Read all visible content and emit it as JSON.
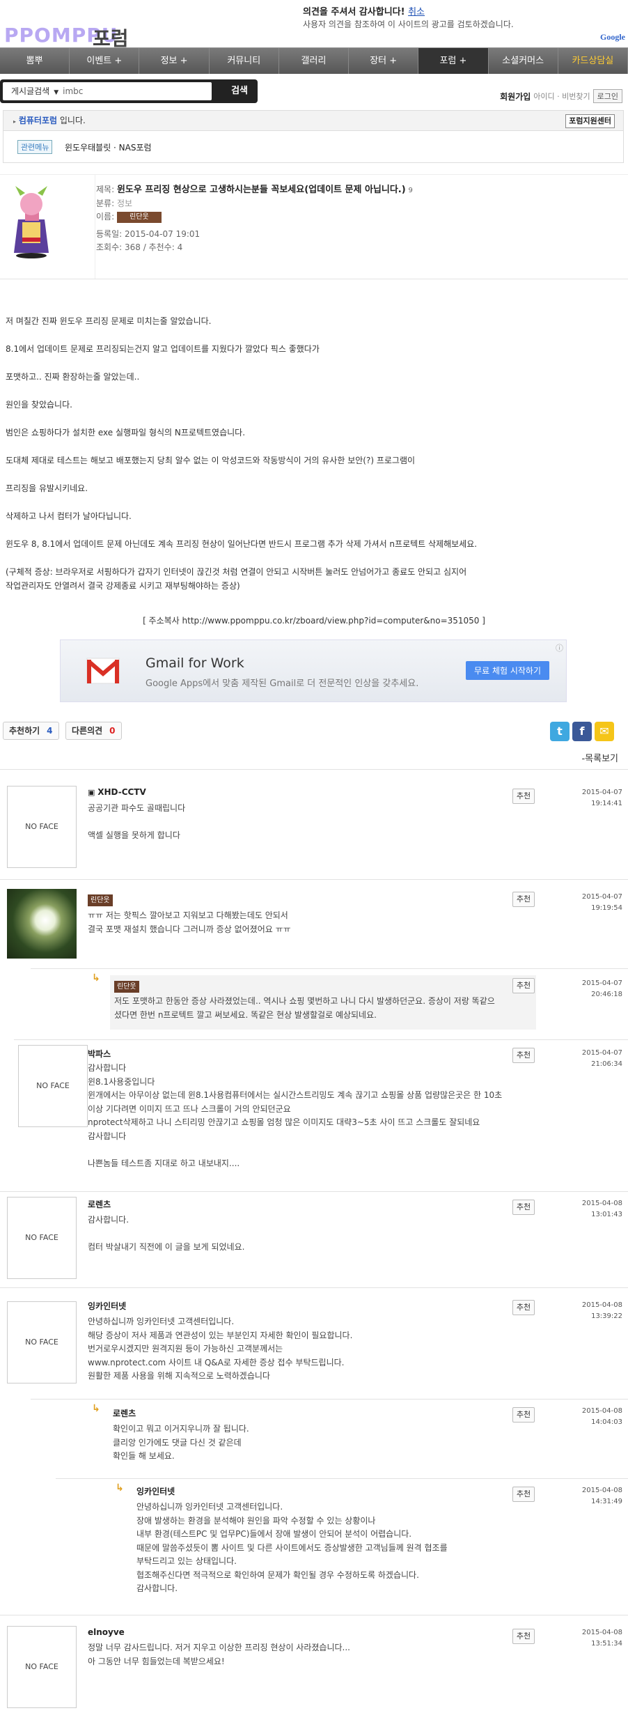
{
  "header": {
    "logo": "PPOMPPU",
    "logo_suffix": "포럼",
    "ad_title": "의견을 주셔서 감사합니다!",
    "ad_cancel": "취소",
    "ad_sub": "사용자 의견을 참조하여 이 사이트의 광고를 검토하겠습니다.",
    "google": "Google"
  },
  "nav": [
    "뽐뿌",
    "이벤트 +",
    "정보 +",
    "커뮤니티",
    "갤러리",
    "장터 +",
    "포럼 +",
    "소셜커머스",
    "카드상담실"
  ],
  "search": {
    "select": "게시글검색",
    "query": "imbc",
    "button": "검색"
  },
  "member": {
    "join": "회원가입",
    "find": "아이디 · 비번찾기",
    "login": "로그인"
  },
  "breadcrumb": {
    "link": "컴퓨터포럼",
    "suffix": "입니다.",
    "support": "포럼지원센터"
  },
  "related": {
    "tag": "관련메뉴",
    "text": "윈도우태블릿 · NAS포럼"
  },
  "post": {
    "title_label": "제목:",
    "title": "윈도우 프리징 현상으로 고생하시는분들 꼭보세요(업데이트 문제 아닙니다.)",
    "title_count": "9",
    "category_label": "분류:",
    "category": "정보",
    "name_label": "이름:",
    "nick": "린단웃",
    "date_label": "등록일:",
    "date": "2015-04-07 19:01",
    "views_label": "조회수:",
    "views": "368",
    "rec_label": "/ 추천수:",
    "recs": "4"
  },
  "body": [
    "저 며칠간 진짜 윈도우 프리징 문제로 미치는줄 알았습니다.",
    "8.1에서 업데이트 문제로 프리징되는건지 알고 업데이트를 지웠다가 깔았다 픽스 좋했다가",
    "포맷하고.. 진짜 환장하는줄 알았는데..",
    "원인을 찾았습니다.",
    "범인은 쇼핑하다가 설치한 exe 실행파일 형식의 N프로텍트였습니다.",
    "도대체 제대로 테스트는 해보고 배포했는지 당최 알수 없는 이 악성코드와 작동방식이 거의 유사한 보안(?) 프로그램이",
    "프리징을 유발시키네요.",
    "삭제하고 나서 컴터가 날아다닙니다.",
    "윈도우 8, 8.1에서 업데이트 문제 아닌데도 계속 프리징 현상이 일어난다면 반드시 프로그램 추가 삭제 가셔서 n프로텍트 삭제해보세요.",
    "(구체적 증상: 브라우저로 서핑하다가 갑자기 인터넷이 끊긴것 처럼 연결이 안되고 시작버튼 눌러도 안넘어가고 종료도 안되고 심지어",
    "작업관리자도 안열려서 결국 강제종료 시키고 재부팅해야하는 증상)"
  ],
  "address": "[ 주소복사 http://www.ppomppu.co.kr/zboard/view.php?id=computer&no=351050 ]",
  "gmail_ad": {
    "headline": "Gmail for Work",
    "sub": "Google Apps에서 맞춤 제작된 Gmail로 더 전문적인 인상을 갖추세요.",
    "cta": "무료 체험 시작하기"
  },
  "actions": {
    "recommend": "추천하기",
    "recommend_count": "4",
    "dissent": "다른의견",
    "dissent_count": "0",
    "back": "-목록보기"
  },
  "comment_ui": {
    "no_face": "NO FACE",
    "recommend": "추천"
  },
  "comments": [
    {
      "name": "XHD-CCTV",
      "text": "공공기관 파수도 골때립니다\n\n액셀 실행을 못하게 합니다",
      "date": "2015-04-07",
      "time": "19:14:41"
    },
    {
      "name": "",
      "badge": "린단웃",
      "text": "ㅠㅠ 저는 핫픽스 깔아보고 지워보고 다해봤는데도 안되서\n결국 포맷 재설치 했습니다 그러니까 증상 없어졌어요 ㅠㅠ",
      "date": "2015-04-07",
      "time": "19:19:54"
    },
    {
      "name": "",
      "badge": "린단웃",
      "text": "저도 포맷하고 한동안 증상 사라졌었는데.. 역시나 쇼핑 몇번하고 나니 다시 발생하던군요. 증상이 저랑 똑같으\n셨다면 한번 n프로텍트 깔고 써보세요. 똑같은 현상 발생할걸로 예상되네요.",
      "date": "2015-04-07",
      "time": "20:46:18"
    },
    {
      "name": "박파스",
      "text": "감사합니다\n윈8.1사용중입니다\n윈개에서는 아무이상 없는데 윈8.1사용컴퓨터에서는 실시간스트리밍도 계속 끊기고 쇼핑몰 상품 업량많은곳은 한 10초\n이상 기다려면 이미지 뜨고 뜨나 스크롤이 거의 안되던군요\nnprotect삭제하고 나니 스티리밍 안끊기고 쇼핑몰 엄청 많은 이미지도 대략3~5초 사이 뜨고 스크롤도 잘되네요\n감사합니다\n\n나쁜놈들 테스트좀 지대로 하고 내보내지....",
      "date": "2015-04-07",
      "time": "21:06:34"
    },
    {
      "name": "로렌츠",
      "text": "감사합니다.\n\n컴터 박살내기 직전에 이 글을 보게 되었네요.",
      "date": "2015-04-08",
      "time": "13:01:43"
    },
    {
      "name": "잉카인터넷",
      "text": "안녕하십니까 잉카인터넷 고객센터입니다.\n해당 증상이 저사 제품과 연관성이 있는 부분인지 자세한 확인이 필요합니다.\n번거로우시겠지만 원격지원 등이 가능하신 고객분께서는\nwww.nprotect.com 사이트 내 Q&A로 자세한 증상 접수 부탁드립니다.\n원활한 제품 사용을 위해 지속적으로 노력하겠습니다",
      "date": "2015-04-08",
      "time": "13:39:22"
    },
    {
      "name": "로렌츠",
      "text": "확인이고 뭐고 이거지우니까 잘 됩니다.\n클리앙 인가에도 댓글 다신 것 같은데\n확인들 해 보세요.",
      "date": "2015-04-08",
      "time": "14:04:03"
    },
    {
      "name": "잉카인터넷",
      "text": "안녕하십니까 잉카인터넷 고객센터입니다.\n장애 발생하는 환경을 분석해야 원인을 파악 수정할 수 있는 상황이나\n내부 환경(테스트PC 및 업무PC)들에서 장애 발생이 안되어 분석이 어렵습니다.\n때문에 말씀주셨듯이 뽐 사이트 및 다른 사이트에서도 증상발생한 고객님들께 원격 협조를\n부탁드리고 있는 상태입니다.\n협조해주신다면 적극적으로 확인하여 문제가 확인될 경우 수정하도록 하겠습니다.\n감사합니다.",
      "date": "2015-04-08",
      "time": "14:31:49"
    },
    {
      "name": "elnoyve",
      "text": "정말 너무 감사드립니다. 저거 지우고 이상한 프리징 현상이 사라졌습니다...\n아 그동안 너무 힘들었는데 복받으세요!",
      "date": "2015-04-08",
      "time": "13:51:34"
    }
  ],
  "colors": {
    "nav_active": "#333333",
    "link": "#2a5bbf",
    "accent_yellow": "#ffcc33"
  }
}
